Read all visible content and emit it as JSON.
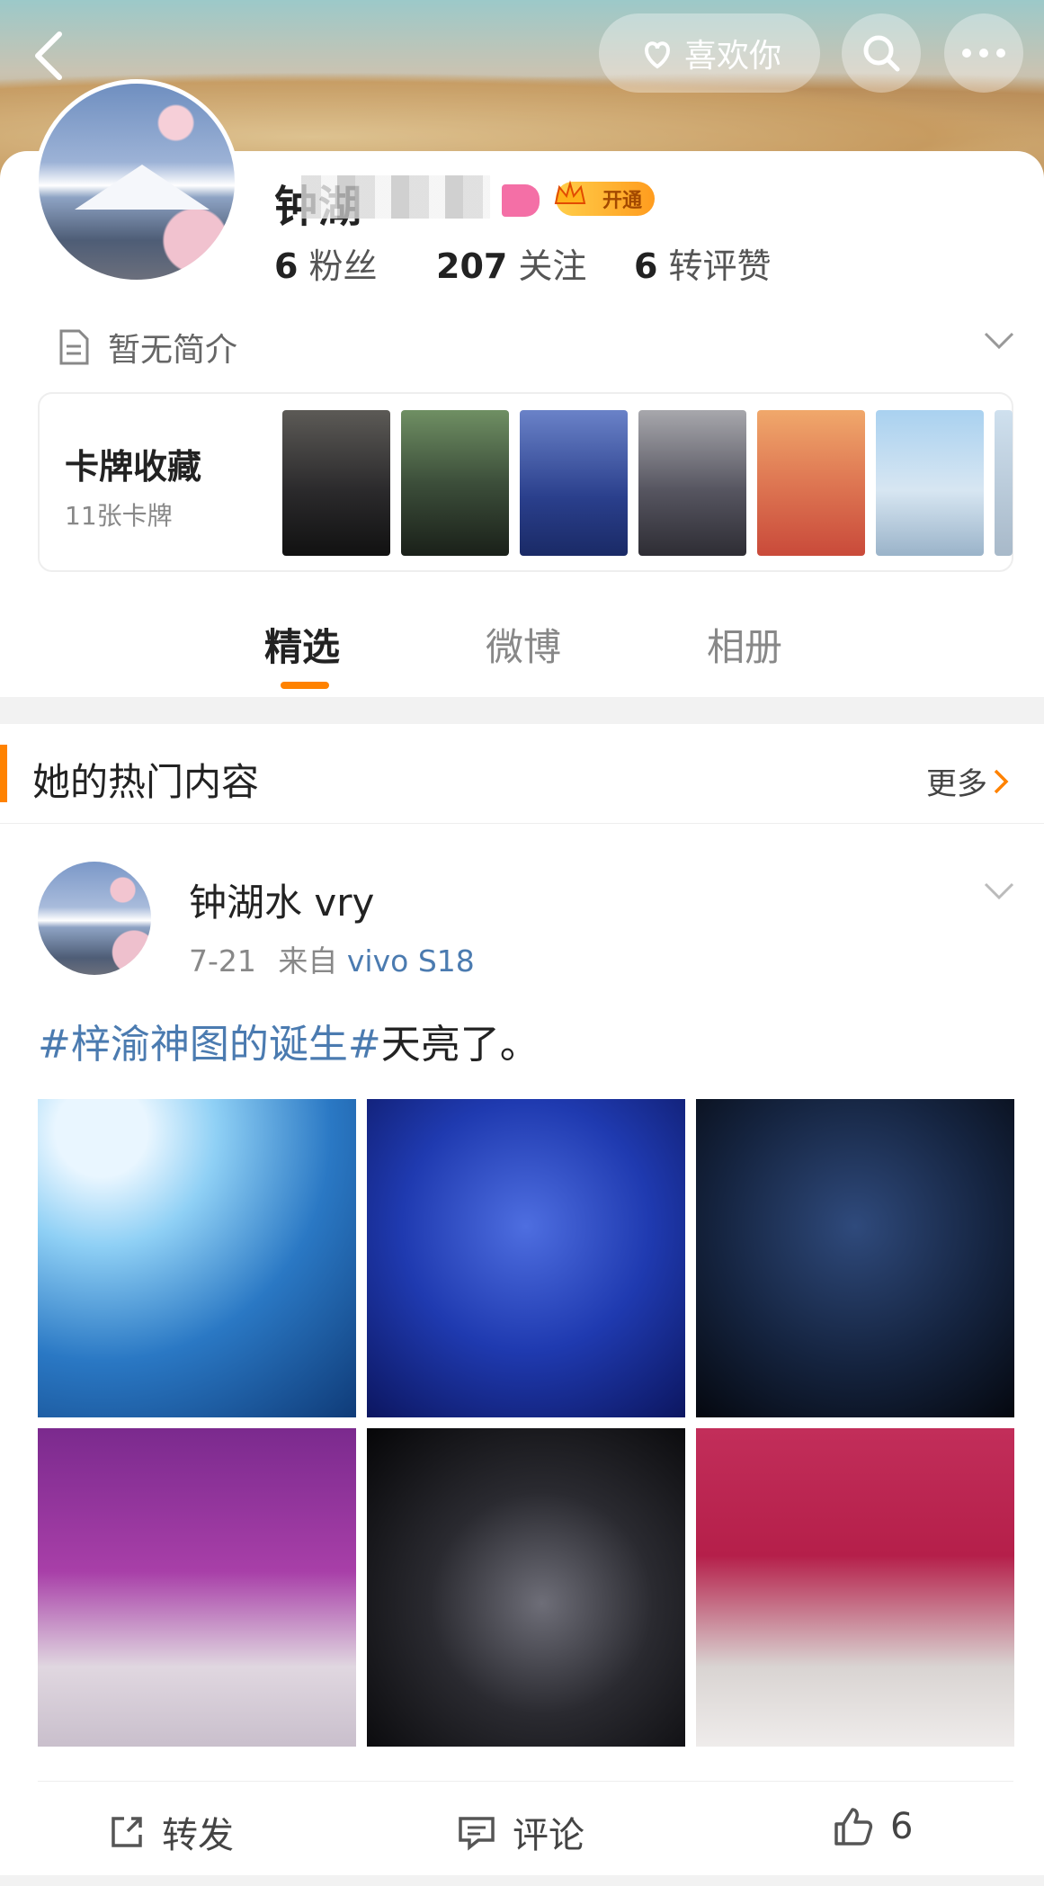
{
  "header": {
    "back_icon": "chevron-left-icon",
    "like_label": "喜欢你",
    "search_icon": "search-icon",
    "more_icon": "more-dots-icon"
  },
  "profile": {
    "name_visible": "钟湖",
    "stats": [
      {
        "num": "6",
        "label": "粉丝"
      },
      {
        "num": "207",
        "label": "关注"
      },
      {
        "num": "6",
        "label": "转评赞"
      }
    ],
    "member_badge": "开通",
    "intro": "暂无简介"
  },
  "card_collection": {
    "title": "卡牌收藏",
    "subtitle": "11张卡牌"
  },
  "tabs": [
    {
      "label": "精选",
      "active": true
    },
    {
      "label": "微博",
      "active": false
    },
    {
      "label": "相册",
      "active": false
    }
  ],
  "hot_section": {
    "title": "她的热门内容",
    "more": "更多"
  },
  "post": {
    "author": "钟湖水 vry",
    "date": "7-21",
    "from": "来自",
    "source": "vivo S18",
    "hashtag": "#梓渝神图的诞生#",
    "text": "天亮了。",
    "actions": {
      "repost": "转发",
      "comment": "评论",
      "like_count": "6"
    }
  },
  "colors": {
    "accent": "#ff8200",
    "link": "#4b7bb0"
  }
}
